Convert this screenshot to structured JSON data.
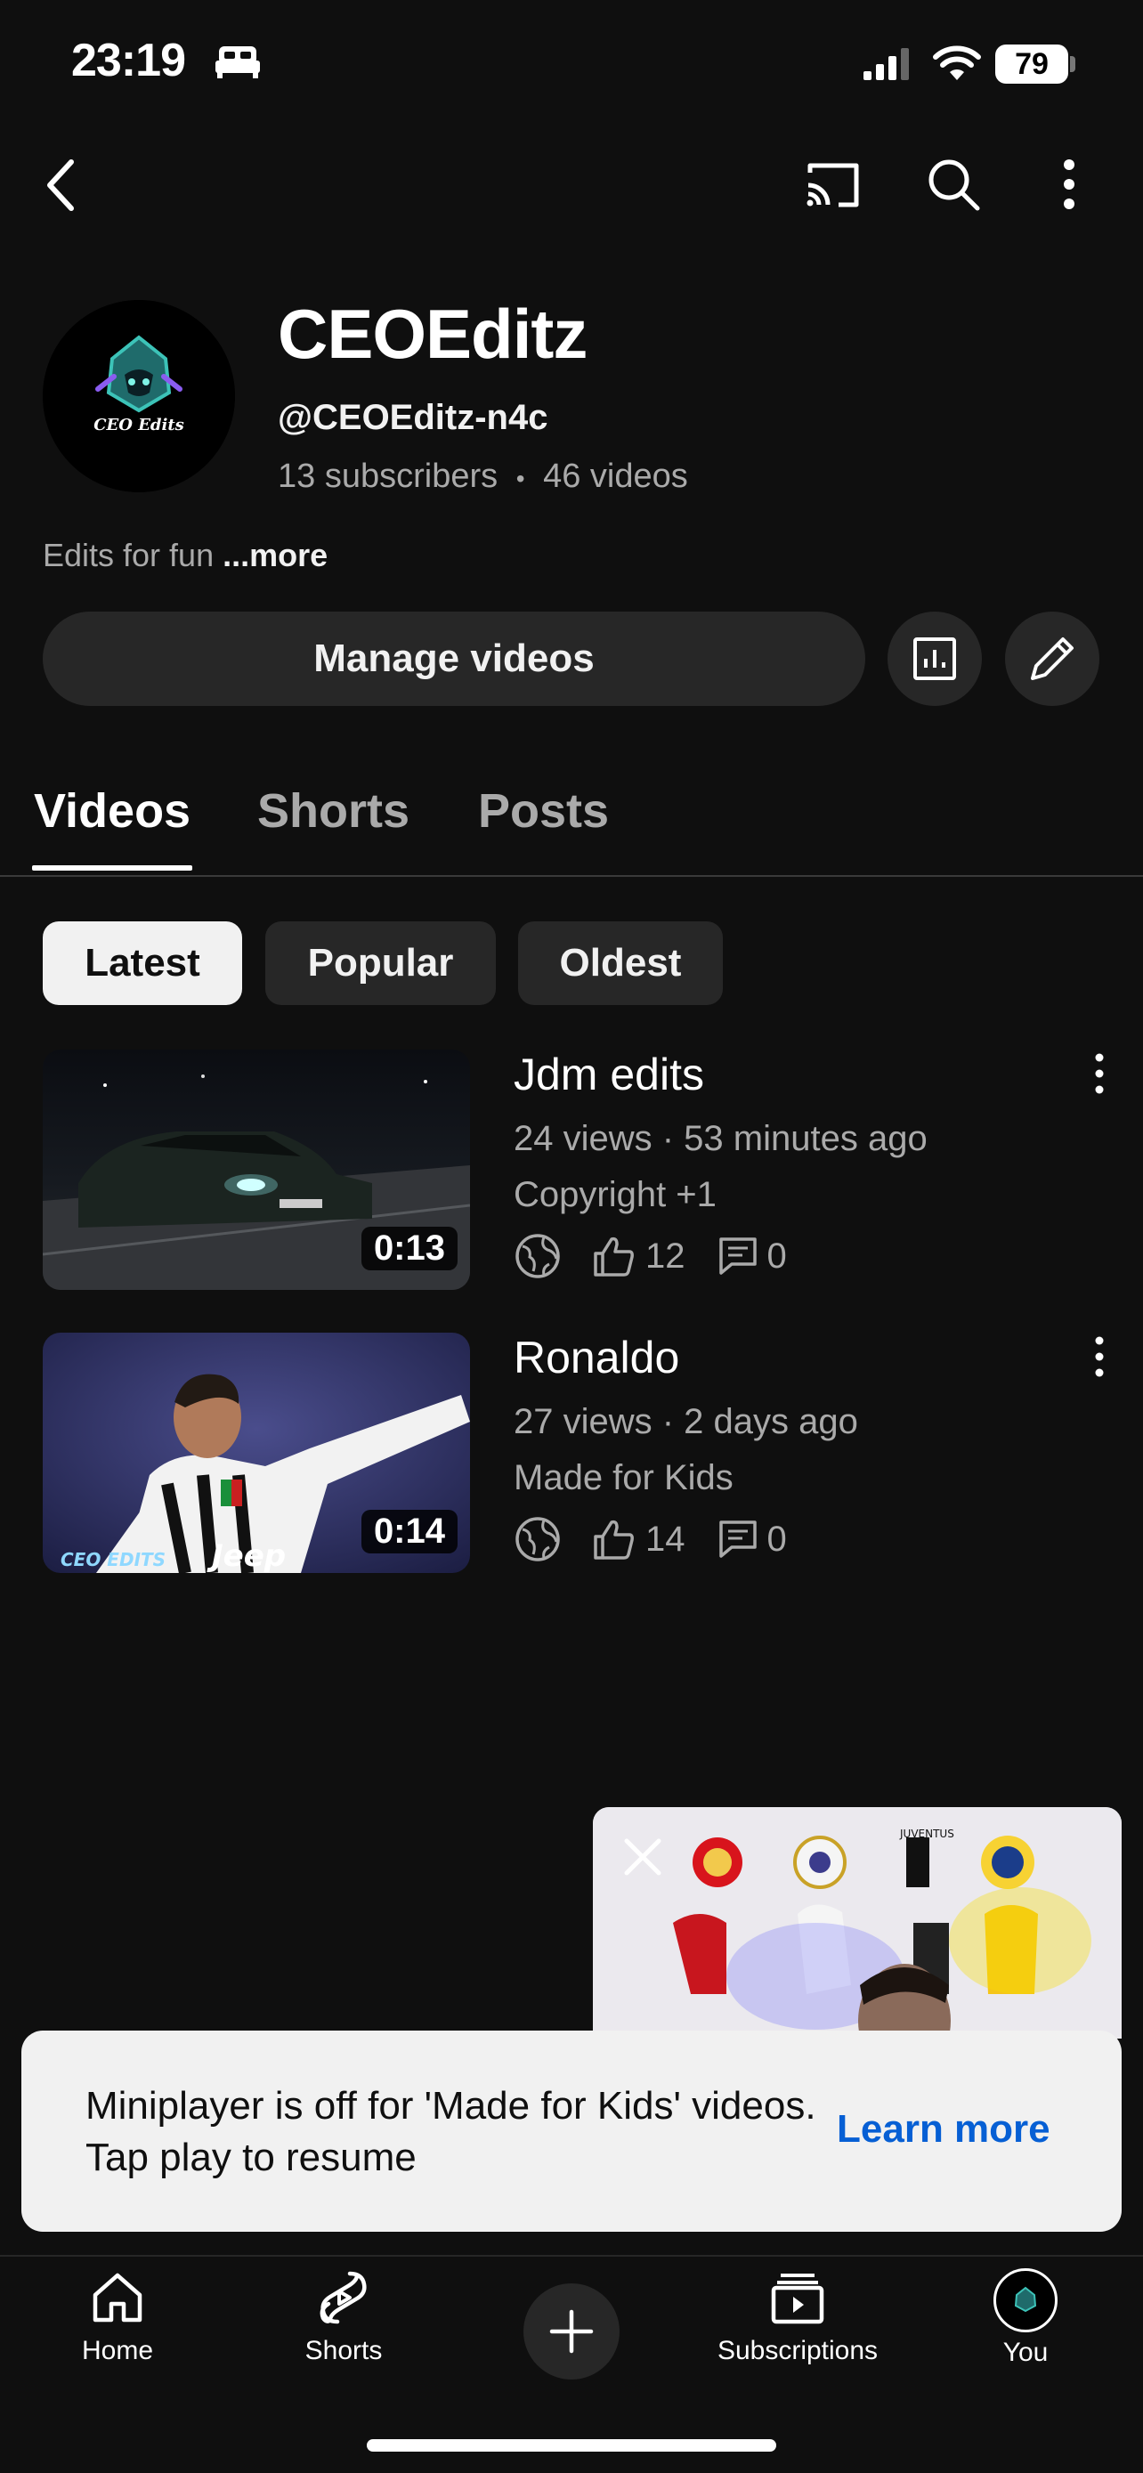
{
  "status_bar": {
    "time": "23:19",
    "battery": "79"
  },
  "channel": {
    "name": "CEOEditz",
    "handle": "@CEOEditz-n4c",
    "subscribers": "13 subscribers",
    "separator": "•",
    "videos_count": "46 videos",
    "description": "Edits for fun",
    "more_label": "...more",
    "avatar_text": "CEO Edits"
  },
  "actions": {
    "manage_videos": "Manage videos"
  },
  "tabs": [
    {
      "label": "Videos",
      "active": true
    },
    {
      "label": "Shorts",
      "active": false
    },
    {
      "label": "Posts",
      "active": false
    }
  ],
  "chips": [
    {
      "label": "Latest",
      "active": true
    },
    {
      "label": "Popular",
      "active": false
    },
    {
      "label": "Oldest",
      "active": false
    }
  ],
  "videos": [
    {
      "title": "Jdm edits",
      "meta": "24 views · 53 minutes ago",
      "label": "Copyright +1",
      "likes": "12",
      "comments": "0",
      "duration": "0:13"
    },
    {
      "title": "Ronaldo",
      "meta": "27 views · 2 days ago",
      "label": "Made for Kids",
      "likes": "14",
      "comments": "0",
      "duration": "0:14"
    }
  ],
  "toast": {
    "message": "Miniplayer is off for 'Made for Kids' videos. Tap play to resume",
    "link": "Learn more"
  },
  "bottom_nav": {
    "home": "Home",
    "shorts": "Shorts",
    "subscriptions": "Subscriptions",
    "you": "You"
  },
  "colors": {
    "background": "#0f0f0f",
    "surface": "#272727",
    "link_blue": "#065fd4",
    "secondary_text": "#aaaaaa"
  }
}
